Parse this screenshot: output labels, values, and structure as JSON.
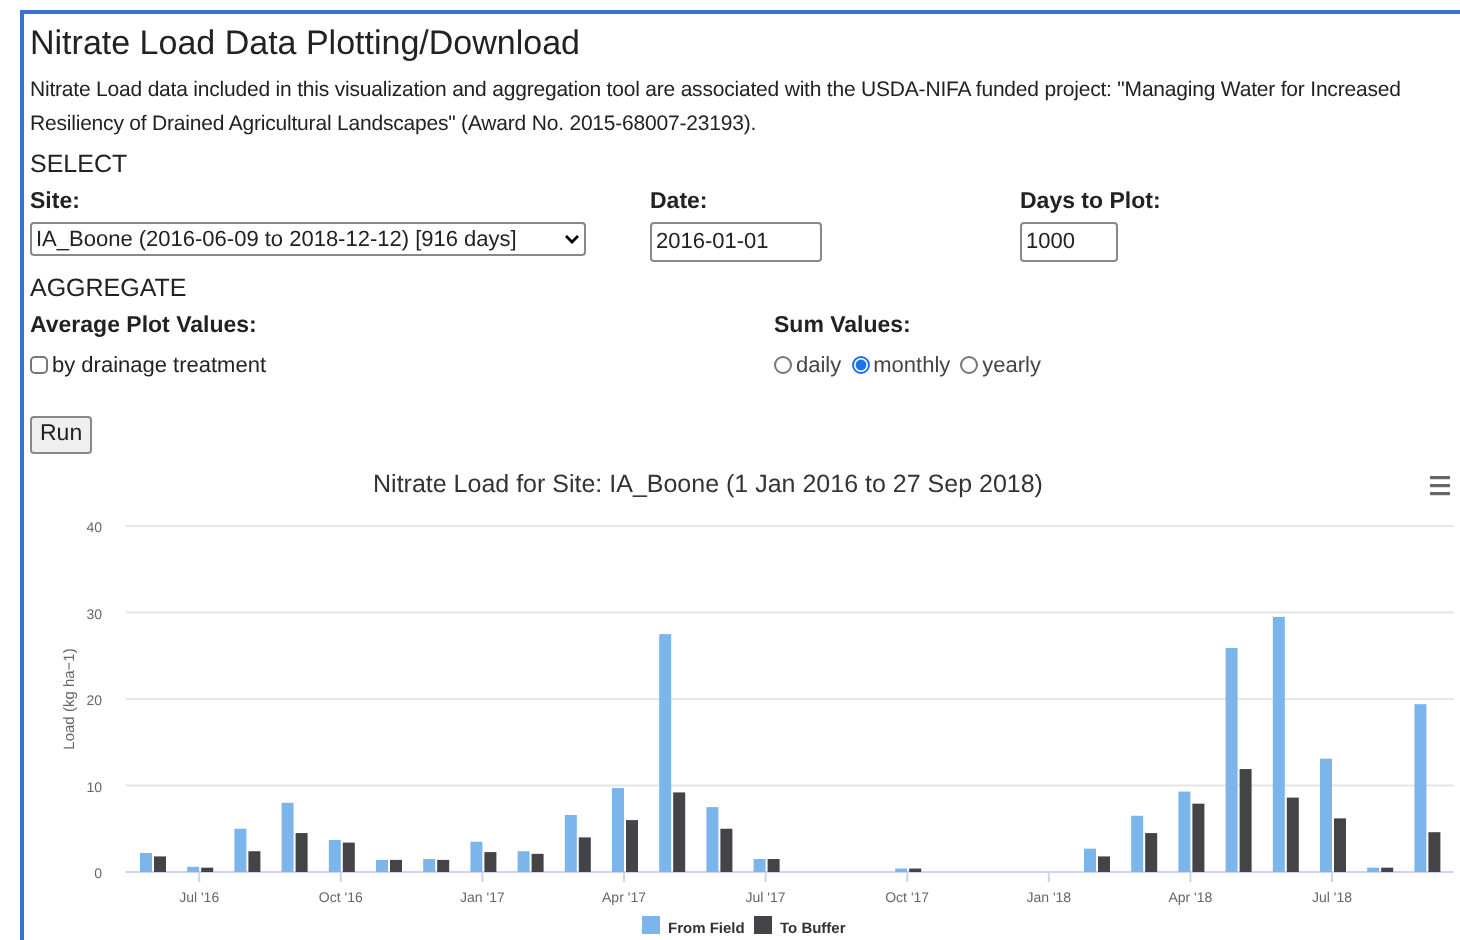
{
  "title": "Nitrate Load Data Plotting/Download",
  "description": "Nitrate Load data included in this visualization and aggregation tool are associated with the USDA-NIFA funded project: \"Managing Water for Increased Resiliency of Drained Agricultural Landscapes\" (Award No. 2015-68007-23193).",
  "select_section": {
    "heading": "SELECT",
    "site": {
      "label": "Site:",
      "value": "IA_Boone (2016-06-09 to 2018-12-12) [916 days]"
    },
    "date": {
      "label": "Date:",
      "value": "2016-01-01"
    },
    "days": {
      "label": "Days to Plot:",
      "value": "1000"
    }
  },
  "aggregate_section": {
    "heading": "AGGREGATE",
    "average": {
      "label": "Average Plot Values:",
      "option": {
        "label": "by drainage treatment",
        "checked": false
      }
    },
    "sum": {
      "label": "Sum Values:",
      "options": [
        {
          "label": "daily",
          "selected": false
        },
        {
          "label": "monthly",
          "selected": true
        },
        {
          "label": "yearly",
          "selected": false
        }
      ]
    }
  },
  "run_button": "Run",
  "chart": {
    "chart_data": {
      "type": "bar",
      "title": "Nitrate Load for Site: IA_Boone (1 Jan 2016 to 27 Sep 2018)",
      "ylabel": "Load (kg ha−1)",
      "categories": [
        null,
        "Jul '16",
        null,
        null,
        "Oct '16",
        null,
        null,
        "Jan '17",
        null,
        null,
        "Apr '17",
        null,
        null,
        "Jul '17",
        null,
        null,
        "Oct '17",
        null,
        null,
        "Jan '18",
        null,
        null,
        "Apr '18",
        null,
        null,
        "Jul '18",
        null,
        null
      ],
      "ylim": [
        0,
        40
      ],
      "grid": true,
      "legend": "bottom",
      "yticks": [
        0,
        10,
        20,
        30,
        40
      ],
      "series": [
        {
          "name": "From Field",
          "color": "#7cb5ec",
          "values": [
            2.2,
            0.6,
            5.0,
            8.0,
            3.7,
            1.4,
            1.5,
            3.5,
            2.4,
            6.6,
            9.7,
            27.5,
            7.5,
            1.5,
            null,
            null,
            0.4,
            null,
            null,
            null,
            2.7,
            6.5,
            9.3,
            25.9,
            29.5,
            13.1,
            0.5,
            19.4
          ]
        },
        {
          "name": "To Buffer",
          "color": "#434348",
          "values": [
            1.8,
            0.5,
            2.4,
            4.5,
            3.4,
            1.4,
            1.4,
            2.3,
            2.1,
            4.0,
            6.0,
            9.2,
            5.0,
            1.5,
            null,
            null,
            0.4,
            null,
            null,
            null,
            1.8,
            4.5,
            7.9,
            11.9,
            8.6,
            6.2,
            0.5,
            4.6
          ]
        }
      ]
    }
  }
}
